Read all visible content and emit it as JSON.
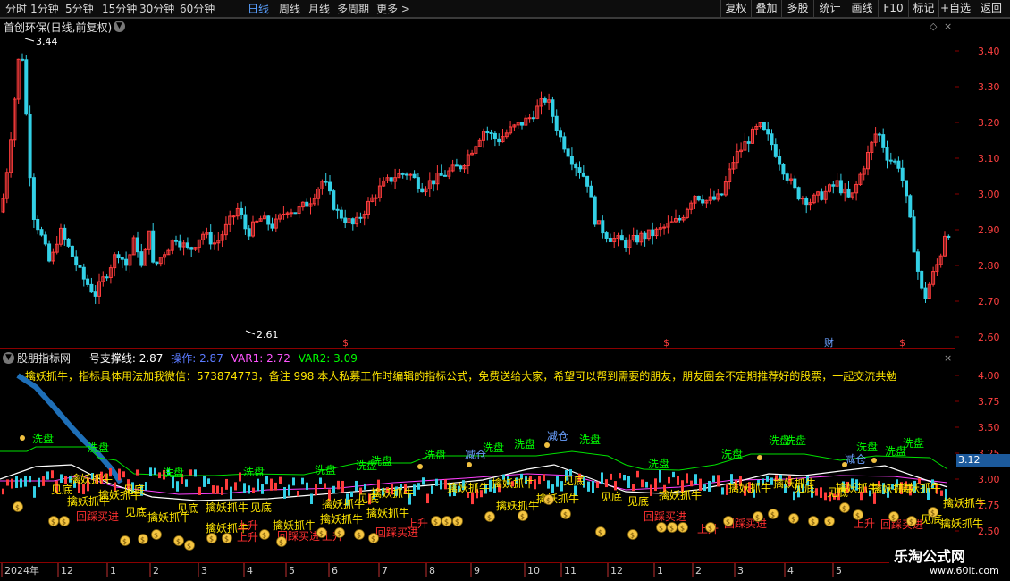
{
  "toolbar": {
    "periods": [
      "分时",
      "1分钟",
      "5分钟",
      "15分钟",
      "30分钟",
      "60分钟",
      "日线",
      "周线",
      "月线",
      "多周期",
      "更多"
    ],
    "active_period": "日线",
    "right_buttons": [
      "复权",
      "叠加",
      "多股",
      "统计",
      "画线",
      "F10",
      "标记",
      "+自选",
      "返回"
    ]
  },
  "main_chart": {
    "title": "首创环保(日线,前复权)",
    "high_label": "3.44",
    "low_label": "2.61",
    "y_ticks": [
      "3.40",
      "3.30",
      "3.20",
      "3.10",
      "3.00",
      "2.90",
      "2.80",
      "2.70",
      "2.60"
    ],
    "event_markers": [
      "$",
      "$",
      "财",
      "$"
    ]
  },
  "indicator": {
    "name": "股朋指标网",
    "line1": "一号支撑线: 2.87",
    "line2": "操作: 2.87",
    "line3": "VAR1: 2.72",
    "line4": "VAR2: 3.09",
    "promo": "擒妖抓牛，指标具体用法加我微信：573874773，备注 998 本人私募工作时编辑的指标公式，免费送给大家，希望可以帮到需要的朋友，朋友圈会不定期推荐好的股票，一起交流共勉",
    "y_ticks": [
      "4.00",
      "3.75",
      "3.50",
      "3.25",
      "3.00",
      "2.75",
      "2.50"
    ],
    "current_price": "3.12",
    "labels": {
      "wash": "洗盘",
      "catch": "擒妖抓牛",
      "bottom": "见底",
      "reduce": "减仓",
      "rise": "上升",
      "buy": "回踩买进"
    }
  },
  "time_axis": {
    "labels": [
      "2024年",
      "12",
      "1",
      "2",
      "3",
      "4",
      "5",
      "6",
      "7",
      "8",
      "9",
      "10",
      "11",
      "12",
      "1",
      "2",
      "3",
      "4",
      "5"
    ]
  },
  "watermark": {
    "name": "乐淘公式网",
    "url": "www.60lt.com"
  },
  "colors": {
    "up": "#ff3c3c",
    "down": "#33d0e6",
    "wash": "#00ff00",
    "catch": "#ffe600",
    "reduce": "#6aa0ff",
    "buy": "#ff3030",
    "grid": "#8b0000"
  }
}
